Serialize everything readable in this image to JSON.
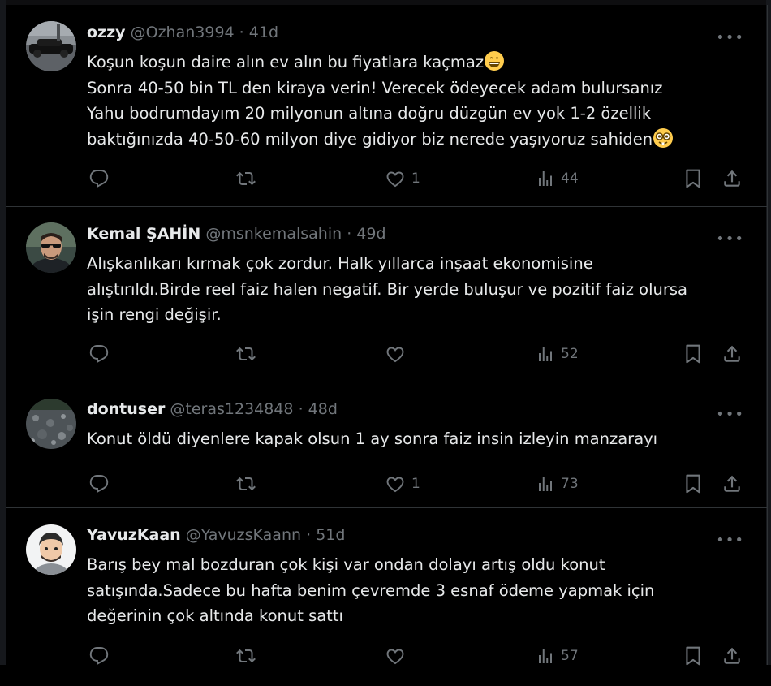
{
  "tweets": [
    {
      "name": "ozzy",
      "handle": "@Ozhan3994",
      "time": "41d",
      "lines": [
        "Koşun koşun daire alın ev alın bu fiyatlara kaçmaz",
        "Sonra 40-50 bin TL den kiraya verin! Verecek ödeyecek adam bulursanız",
        "Yahu bodrumdayım 20 milyonun altına doğru düzgün ev yok 1-2 özellik",
        "baktığınızda 40-50-60 milyon diye gidiyor biz nerede yaşıyoruz sahiden"
      ],
      "emojis": [
        "grinning-face-emoji",
        "nerd-face-emoji"
      ],
      "likes": "1",
      "views": "44"
    },
    {
      "name": "Kemal ŞAHİN",
      "handle": "@msnkemalsahin",
      "time": "49d",
      "lines": [
        "Alışkanlıkarı kırmak çok zordur. Halk yıllarca inşaat ekonomisine",
        "alıştırıldı.Birde reel faiz halen negatif. Bir yerde buluşur ve pozitif faiz olursa",
        "işin rengi değişir."
      ],
      "likes": "",
      "views": "52"
    },
    {
      "name": "dontuser",
      "handle": "@teras1234848",
      "time": "48d",
      "lines": [
        "Konut öldü diyenlere kapak olsun 1 ay sonra faiz insin izleyin manzarayı"
      ],
      "likes": "1",
      "views": "73"
    },
    {
      "name": "YavuzKaan",
      "handle": "@YavuzsKaann",
      "time": "51d",
      "lines": [
        "Barış bey mal bozduran çok kişi var ondan dolayı artış oldu konut",
        "satışında.Sadece bu hafta benim çevremde 3 esnaf ödeme yapmak için",
        "değerinin çok altında konut sattı"
      ],
      "likes": "",
      "views": "57"
    }
  ],
  "separator": "·",
  "more_label": "•••",
  "colors": {
    "background": "#000000",
    "text": "#e7e9ea",
    "muted": "#71767b",
    "border": "#2f3336"
  }
}
